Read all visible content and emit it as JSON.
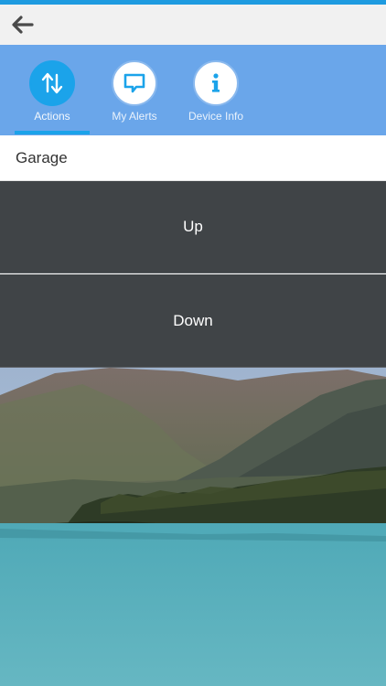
{
  "toolbar": {
    "back_icon": "arrow-left-icon"
  },
  "tabs": [
    {
      "label": "Actions",
      "icon": "up-down-arrows-icon",
      "active": true
    },
    {
      "label": "My Alerts",
      "icon": "speech-bubble-icon",
      "active": false
    },
    {
      "label": "Device Info",
      "icon": "info-icon",
      "active": false
    }
  ],
  "device": {
    "name": "Garage"
  },
  "actions": {
    "up_label": "Up",
    "down_label": "Down"
  },
  "colors": {
    "accent": "#1ba3ea",
    "tabbar_bg": "#6aa6ea",
    "action_bg": "#404447",
    "lake": "#5ab0bd"
  },
  "background": {
    "scene": "mountain-lake-photo"
  }
}
